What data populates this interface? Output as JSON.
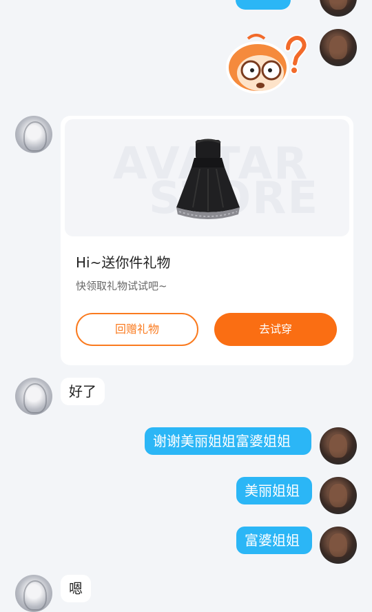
{
  "colors": {
    "self_bubble": "#2bb6f6",
    "accent_orange": "#fa6e13",
    "background": "#f3f5f8"
  },
  "messages": {
    "top_partial": "",
    "sticker": "confused-question-sticker",
    "peer_ok": "好了",
    "self_thanks": "谢谢美丽姐姐富婆姐姐",
    "self_beautiful": "美丽姐姐",
    "self_rich": "富婆姐姐",
    "peer_en": "嗯"
  },
  "gift_card": {
    "watermark_line1": "AVATAR",
    "watermark_line2": "STORE",
    "title": "Hi~送你件礼物",
    "subtitle": "快领取礼物试试吧~",
    "return_gift_label": "回赠礼物",
    "try_on_label": "去试穿"
  }
}
